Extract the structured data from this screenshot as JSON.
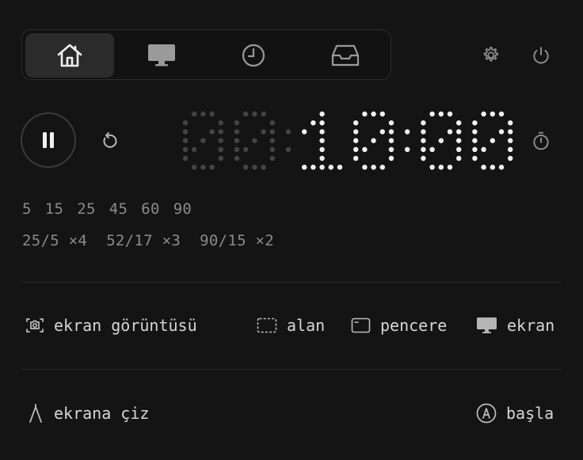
{
  "tabs": [
    {
      "name": "home",
      "icon": "home-icon",
      "active": true
    },
    {
      "name": "display",
      "icon": "monitor-icon",
      "active": false
    },
    {
      "name": "history",
      "icon": "clock-icon",
      "active": false
    },
    {
      "name": "inbox",
      "icon": "inbox-icon",
      "active": false
    }
  ],
  "timer": {
    "display": "00:10:00",
    "dim_digits": 2,
    "controls": {
      "pause": "pause-icon",
      "reset": "reset-icon",
      "stopwatch": "stopwatch-icon"
    }
  },
  "presets": {
    "minutes": [
      "5",
      "15",
      "25",
      "45",
      "60",
      "90"
    ],
    "cycles": [
      "25/5 ×4",
      "52/17 ×3",
      "90/15 ×2"
    ]
  },
  "screenshot": {
    "label": "ekran görüntüsü",
    "options": [
      {
        "label": "alan",
        "icon": "area-select-icon"
      },
      {
        "label": "pencere",
        "icon": "window-icon"
      },
      {
        "label": "ekran",
        "icon": "monitor-icon"
      }
    ]
  },
  "draw": {
    "label": "ekrana çiz",
    "start_label": "başla"
  },
  "colors": {
    "background": "#141414",
    "dot_bright": "#f2f2f2",
    "dot_dim": "#444444",
    "text": "#d6d6d6",
    "muted": "#8a8a8a"
  }
}
